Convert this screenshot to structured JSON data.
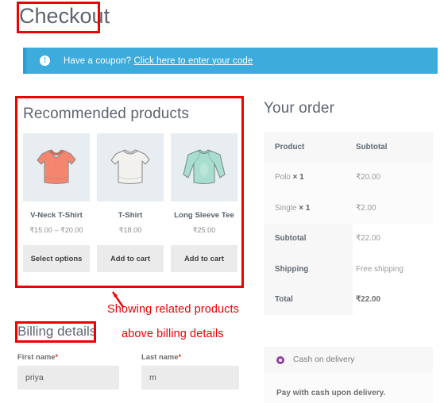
{
  "page": {
    "title": "Checkout"
  },
  "coupon": {
    "icon": "info-icon",
    "text": "Have a coupon? ",
    "link_label": "Click here to enter your code"
  },
  "recommended": {
    "heading": "Recommended products",
    "products": [
      {
        "name": "V-Neck T-Shirt",
        "price": "₹15.00 – ₹20.00",
        "button": "Select options",
        "image": "vneck-tshirt-coral"
      },
      {
        "name": "T-Shirt",
        "price": "₹18.00",
        "button": "Add to cart",
        "image": "tshirt-white"
      },
      {
        "name": "Long Sleeve Tee",
        "price": "₹25.00",
        "button": "Add to cart",
        "image": "long-sleeve-tee-mint"
      }
    ]
  },
  "billing": {
    "heading": "Billing details",
    "first_name": {
      "label": "First name",
      "required_mark": "*",
      "value": "priya"
    },
    "last_name": {
      "label": "Last name",
      "required_mark": "*",
      "value": "m"
    }
  },
  "order": {
    "heading": "Your order",
    "columns": [
      "Product",
      "Subtotal"
    ],
    "items": [
      {
        "name": "Polo",
        "qty": "× 1",
        "subtotal": "₹20.00"
      },
      {
        "name": "Single",
        "qty": "× 1",
        "subtotal": "₹2.00"
      }
    ],
    "totals": [
      {
        "label": "Subtotal",
        "value": "₹22.00"
      },
      {
        "label": "Shipping",
        "value": "Free shipping"
      },
      {
        "label": "Total",
        "value": "₹22.00"
      }
    ]
  },
  "payment": {
    "method_label": "Cash on delivery",
    "description": "Pay with cash upon delivery.",
    "selected": true,
    "accent_color": "#8e3fa5"
  },
  "annotations": {
    "color": "#ee0000",
    "line1": "Showing related products",
    "line2": "above billing details",
    "boxes": [
      "checkout-title",
      "recommended-products",
      "billing-details"
    ],
    "arrow": "diagonal-arrow"
  }
}
